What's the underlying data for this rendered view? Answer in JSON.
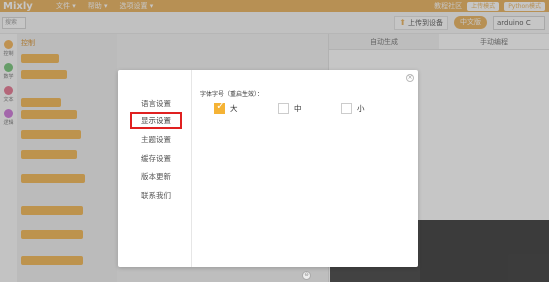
{
  "menubar": {
    "logo": "Mixly",
    "items": [
      "文件 ▾",
      "帮助 ▾",
      "选项设置 ▾"
    ],
    "right": {
      "community": "教程社区",
      "mode_a": "上传模式",
      "mode_b": "Python模式"
    }
  },
  "toolbar": {
    "search_placeholder": "搜索",
    "upload_label": "上传到设备",
    "lang_label": "中文版",
    "board": "arduino C"
  },
  "categories": [
    {
      "label": "控制",
      "color": "#f3a536"
    },
    {
      "label": "数学",
      "color": "#5bb85d"
    },
    {
      "label": "文本",
      "color": "#e15a7a"
    },
    {
      "label": "逻辑",
      "color": "#c35bd0"
    }
  ],
  "blocks": {
    "title": "控制"
  },
  "code_panel": {
    "tabs": [
      "自动生成",
      "手动编程"
    ]
  },
  "modal": {
    "nav": [
      {
        "label": "语言设置",
        "selected": false
      },
      {
        "label": "显示设置",
        "selected": true
      },
      {
        "label": "主题设置",
        "selected": false
      },
      {
        "label": "缓存设置",
        "selected": false
      },
      {
        "label": "版本更新",
        "selected": false
      },
      {
        "label": "联系我们",
        "selected": false
      }
    ],
    "content_title": "字体字号（重启生效）：",
    "options": [
      {
        "label": "大",
        "checked": true
      },
      {
        "label": "中",
        "checked": false
      },
      {
        "label": "小",
        "checked": false
      }
    ],
    "close_glyph": "×"
  }
}
